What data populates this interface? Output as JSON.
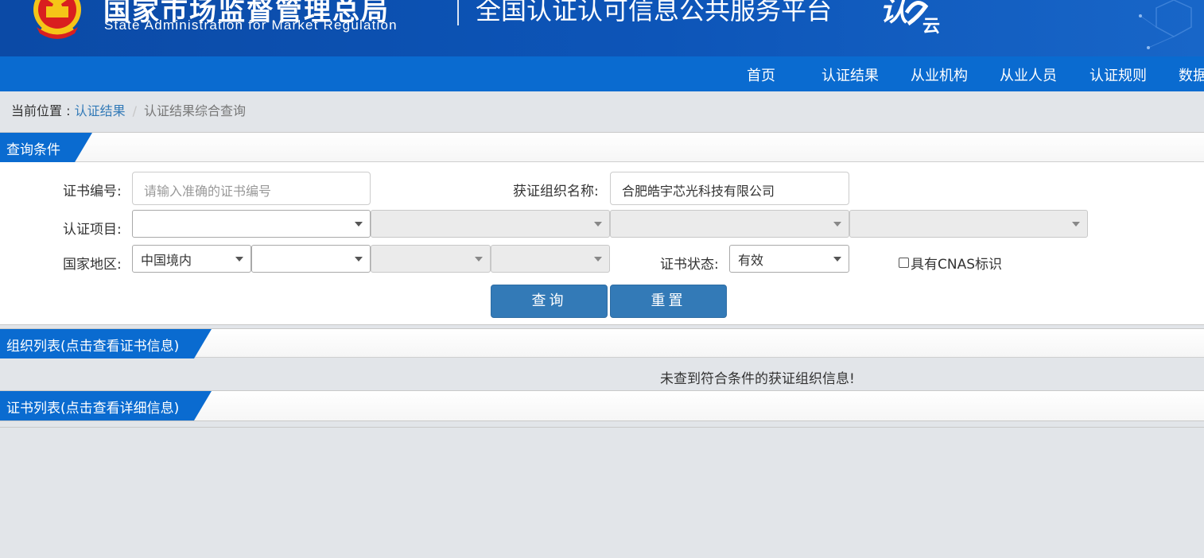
{
  "header": {
    "agency_cn": "国家市场监督管理总局",
    "agency_en": "State Administration  for  Market Regulation",
    "platform_title": "全国认证认可信息公共服务平台",
    "logo_char": "认",
    "logo_sub": "云"
  },
  "nav": {
    "items": [
      {
        "label": "首页"
      },
      {
        "label": "认证结果"
      },
      {
        "label": "从业机构"
      },
      {
        "label": "从业人员"
      },
      {
        "label": "认证规则"
      },
      {
        "label": "数据"
      }
    ]
  },
  "breadcrumb": {
    "prefix": "当前位置 : ",
    "link": "认证结果",
    "separator": "/",
    "current": "认证结果综合查询"
  },
  "query": {
    "section_title": "查询条件",
    "cert_no_label": "证书编号:",
    "cert_no_placeholder": "请输入准确的证书编号",
    "org_name_label": "获证组织名称:",
    "org_name_value": "合肥皓宇芯光科技有限公司",
    "project_label": "认证项目:",
    "region_label": "国家地区:",
    "region_value": "中国境内",
    "status_label": "证书状态:",
    "status_value": "有效",
    "cnas_label": "具有CNAS标识",
    "search_button": "查询",
    "reset_button": "重置"
  },
  "org_list": {
    "section_title": "组织列表(点击查看证书信息)",
    "empty_message": "未查到符合条件的获证组织信息!"
  },
  "cert_list": {
    "section_title": "证书列表(点击查看详细信息)"
  },
  "colors": {
    "banner": "#0b4aa6",
    "nav": "#0a6bd0",
    "button": "#337ab7",
    "link": "#337ab7",
    "background": "#e2e5e9"
  }
}
